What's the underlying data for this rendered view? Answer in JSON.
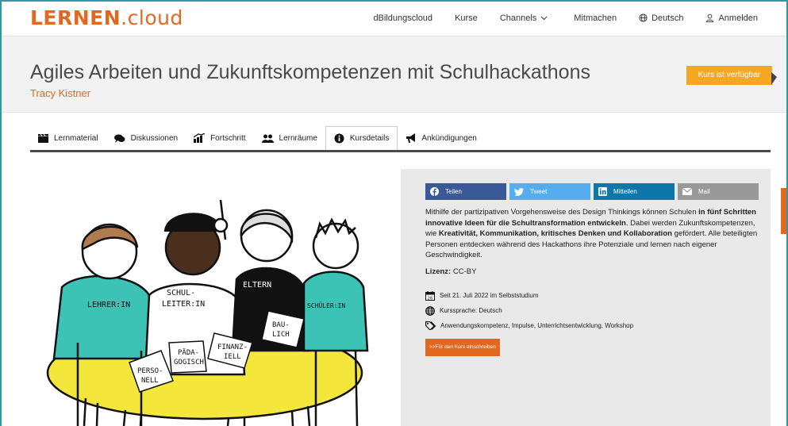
{
  "header": {
    "logo_bold": "LERNEN",
    "logo_rest": ".cloud",
    "nav": {
      "dbildungscloud": "dBildungscloud",
      "kurse": "Kurse",
      "channels": "Channels",
      "mitmachen": "Mitmachen",
      "language": "Deutsch",
      "login": "Anmelden"
    }
  },
  "course": {
    "title": "Agiles Arbeiten und Zukunftskompetenzen mit Schulhackathons",
    "author": "Tracy Kistner",
    "status_badge": "Kurs ist verfügbar"
  },
  "tabs": [
    {
      "label": "Lernmaterial"
    },
    {
      "label": "Diskussionen"
    },
    {
      "label": "Fortschritt"
    },
    {
      "label": "Lernräume"
    },
    {
      "label": "Kursdetails"
    },
    {
      "label": "Ankündigungen"
    }
  ],
  "share": {
    "facebook": "Teilen",
    "twitter": "Tweet",
    "linkedin": "Mitteilen",
    "mail": "Mail"
  },
  "details": {
    "desc_1": "Mithilfe der partizipativen Vorgehensweise des Design Thinkings können Schulen ",
    "desc_2": "in fünf Schritten innovative Ideen für die Schultransformation entwickeln",
    "desc_3": ". Dabei werden Zukunftskompetenzen, wie ",
    "desc_4": "Kreativität, Kommunikation, kritisches Denken und Kollaboration",
    "desc_5": " gefördert. Alle beteiligten Personen entdecken während des Hackathons ihre Potenziale und lernen nach eigener Geschwindigkeit.",
    "license_label": "Lizenz:",
    "license_value": " CC-BY",
    "start": "Seit 21. Juli 2022 im Selbststudium",
    "language": "Kurssprache: Deutsch",
    "tags": "Anwendungskompetenz, Impulse, Unterrichtsentwicklung, Workshop",
    "enroll": ">>Für den Kurs einschreiben",
    "calendar_day": "26"
  },
  "illustration": {
    "shirt_1": "LEHRER:IN",
    "shirt_2a": "SCHUL-",
    "shirt_2b": "LEITER:IN",
    "shirt_3": "ELTERN",
    "shirt_4": "SCHÜLER:IN",
    "paper_1a": "PERSO-",
    "paper_1b": "NELL",
    "paper_2a": "PÄDA-",
    "paper_2b": "GOGISCH",
    "paper_3a": "FINANZ-",
    "paper_3b": "IELL",
    "paper_4a": "BAU-",
    "paper_4b": "LICH"
  },
  "colors": {
    "brand_orange": "#e2671f",
    "badge": "#f5a623",
    "teal": "#3cc3b5",
    "table_yellow": "#f4e63a"
  }
}
